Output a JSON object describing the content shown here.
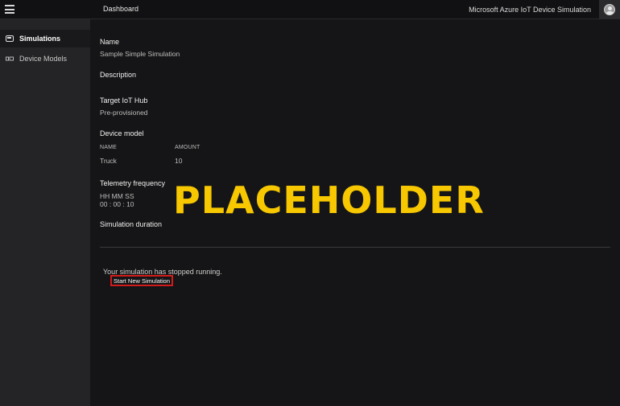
{
  "header": {
    "breadcrumb": "Dashboard",
    "app_title": "Microsoft Azure IoT Device Simulation"
  },
  "sidebar": {
    "items": [
      {
        "label": "Simulations",
        "icon": "simulations-icon",
        "active": true
      },
      {
        "label": "Device Models",
        "icon": "device-models-icon",
        "active": false
      }
    ]
  },
  "main": {
    "name_label": "Name",
    "name_value": "Sample Simple Simulation",
    "description_label": "Description",
    "hub_label": "Target IoT Hub",
    "hub_value": "Pre-provisioned",
    "device_model_label": "Device model",
    "device_table": {
      "headers": [
        "NAME",
        "AMOUNT"
      ],
      "rows": [
        [
          "Truck",
          "10"
        ]
      ]
    },
    "telemetry_label": "Telemetry frequency",
    "telemetry_units": "HH MM SS",
    "telemetry_value": "00 : 00 : 10",
    "duration_label": "Simulation duration",
    "status_text": "Your simulation has stopped running.",
    "start_button": "Start New Simulation",
    "overlay_text": "PLACEHOLDER"
  },
  "colors": {
    "background": "#151517",
    "sidebar": "#242426",
    "overlay": "#f7c700",
    "button_outline": "#d21b1b"
  }
}
